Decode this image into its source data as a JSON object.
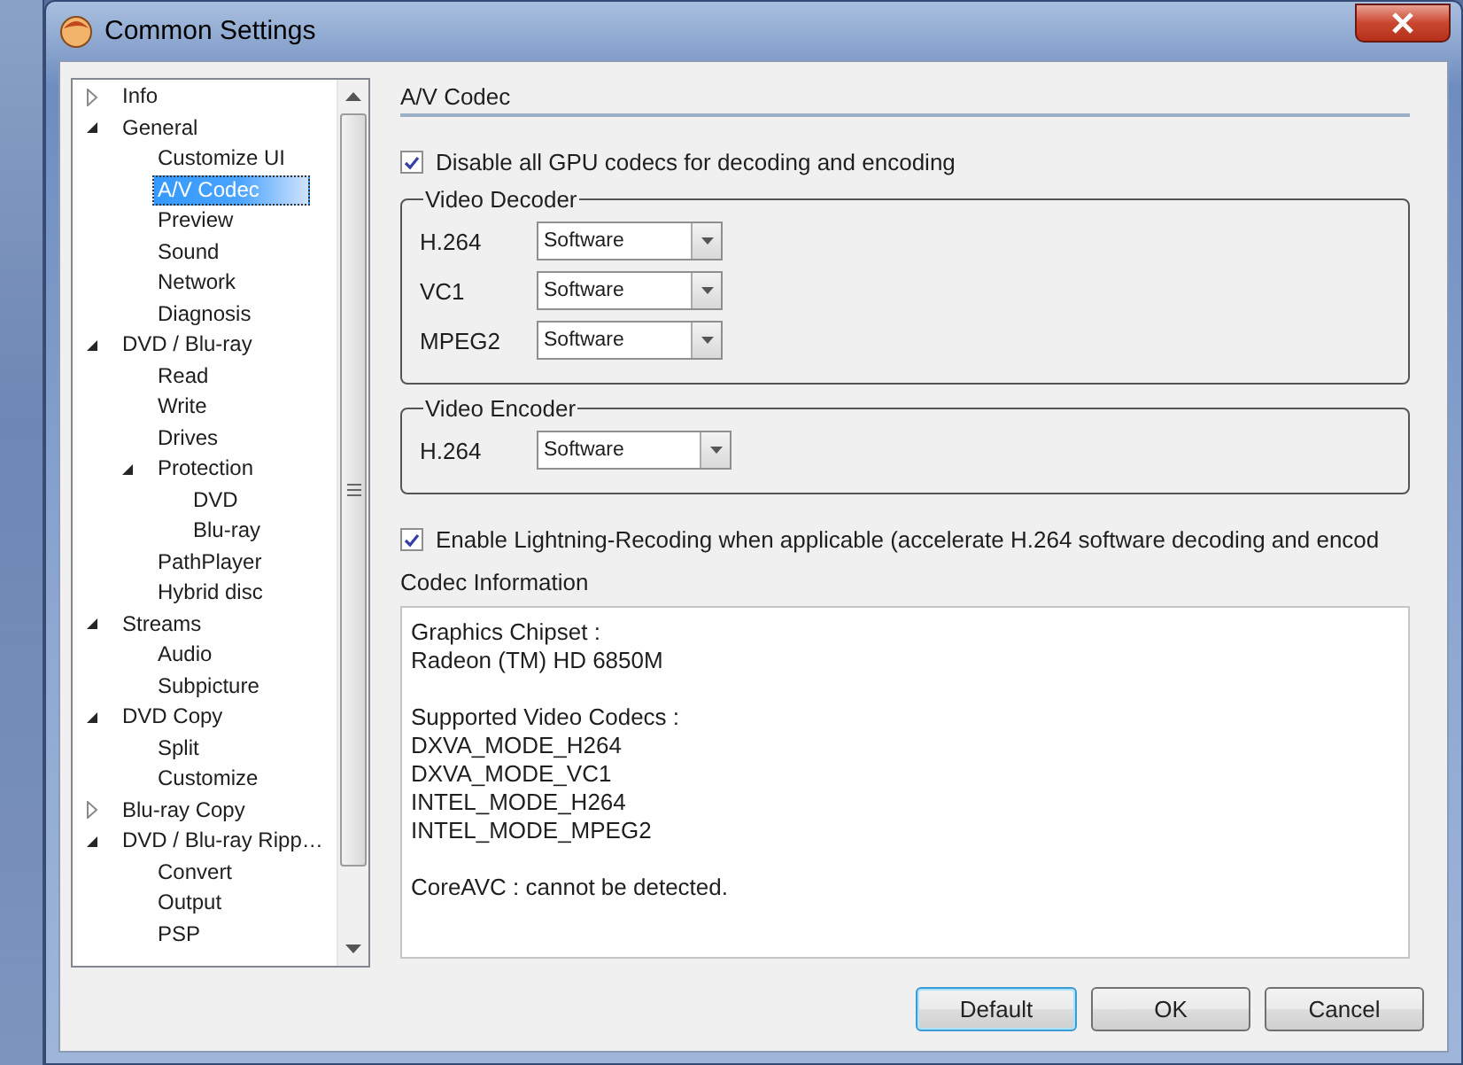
{
  "window": {
    "title": "Common Settings"
  },
  "tree": [
    {
      "label": "Info",
      "expanded": false,
      "selected": false
    },
    {
      "label": "General",
      "expanded": true,
      "selected": false,
      "children": [
        {
          "label": "Customize UI",
          "selected": false
        },
        {
          "label": "A/V Codec",
          "selected": true
        },
        {
          "label": "Preview",
          "selected": false
        },
        {
          "label": "Sound",
          "selected": false
        },
        {
          "label": "Network",
          "selected": false
        },
        {
          "label": "Diagnosis",
          "selected": false
        }
      ]
    },
    {
      "label": "DVD / Blu-ray",
      "expanded": true,
      "selected": false,
      "children": [
        {
          "label": "Read",
          "selected": false
        },
        {
          "label": "Write",
          "selected": false
        },
        {
          "label": "Drives",
          "selected": false
        },
        {
          "label": "Protection",
          "expanded": true,
          "selected": false,
          "children": [
            {
              "label": "DVD",
              "selected": false
            },
            {
              "label": "Blu-ray",
              "selected": false
            }
          ]
        },
        {
          "label": "PathPlayer",
          "selected": false
        },
        {
          "label": "Hybrid disc",
          "selected": false
        }
      ]
    },
    {
      "label": "Streams",
      "expanded": true,
      "selected": false,
      "children": [
        {
          "label": "Audio",
          "selected": false
        },
        {
          "label": "Subpicture",
          "selected": false
        }
      ]
    },
    {
      "label": "DVD Copy",
      "expanded": true,
      "selected": false,
      "children": [
        {
          "label": "Split",
          "selected": false
        },
        {
          "label": "Customize",
          "selected": false
        }
      ]
    },
    {
      "label": "Blu-ray Copy",
      "expanded": false,
      "selected": false
    },
    {
      "label": "DVD / Blu-ray Ripp…",
      "expanded": true,
      "selected": false,
      "children": [
        {
          "label": "Convert",
          "selected": false
        },
        {
          "label": "Output",
          "selected": false
        },
        {
          "label": "PSP",
          "selected": false
        }
      ]
    }
  ],
  "panel": {
    "heading": "A/V Codec",
    "disable_gpu": {
      "label": "Disable all GPU codecs for decoding and encoding",
      "checked": true
    },
    "groups": [
      {
        "title": "Video Decoder",
        "rows": [
          {
            "label": "H.264",
            "value": "Software"
          },
          {
            "label": "VC1",
            "value": "Software"
          },
          {
            "label": "MPEG2",
            "value": "Software"
          }
        ]
      },
      {
        "title": "Video Encoder",
        "rows": [
          {
            "label": "H.264",
            "value": "Software"
          }
        ]
      }
    ],
    "lightning": {
      "label": "Enable Lightning-Recoding when applicable (accelerate H.264 software decoding and encod",
      "checked": true
    },
    "codec_information": {
      "label": "Codec Information",
      "paragraphs": [
        [
          "Graphics Chipset :",
          "Radeon (TM) HD 6850M"
        ],
        [
          "Supported Video Codecs :",
          "DXVA_MODE_H264",
          "DXVA_MODE_VC1",
          "INTEL_MODE_H264",
          "INTEL_MODE_MPEG2"
        ],
        [
          "CoreAVC : cannot be detected."
        ]
      ]
    }
  },
  "buttons": [
    {
      "label": "Default",
      "default": true
    },
    {
      "label": "OK",
      "default": false
    },
    {
      "label": "Cancel",
      "default": false
    }
  ]
}
